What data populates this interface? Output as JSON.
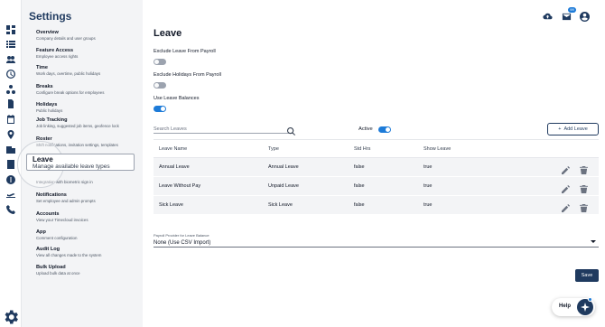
{
  "settings": {
    "title": "Settings",
    "items": [
      {
        "label": "Overview",
        "desc": "Company details and user groups"
      },
      {
        "label": "Feature Access",
        "desc": "Employee access rights"
      },
      {
        "label": "Time",
        "desc": "Work days, overtime, public holidays"
      },
      {
        "label": "Breaks",
        "desc": "Configure break options for employees"
      },
      {
        "label": "Holidays",
        "desc": "Public holidays"
      },
      {
        "label": "Job Tracking",
        "desc": "Job linking, suggested job items, geofence lock"
      },
      {
        "label": "Roster",
        "desc": "Shift notifications, invitation settings, templates"
      },
      {
        "label": "Leave",
        "desc": "Manage available leave types"
      },
      {
        "label": "",
        "desc": "Integration with biometric sign in"
      },
      {
        "label": "Notifications",
        "desc": "Set employee and admin prompts"
      },
      {
        "label": "Accounts",
        "desc": "View your Timecloud invoices"
      },
      {
        "label": "App",
        "desc": "Comment configuration"
      },
      {
        "label": "Audit Log",
        "desc": "View all changes made to the system"
      },
      {
        "label": "Bulk Upload",
        "desc": "Upload bulk data at once"
      }
    ]
  },
  "header": {
    "notification_count": "99"
  },
  "main": {
    "title": "Leave",
    "exclude_payroll_label": "Exclude Leave From Payroll",
    "exclude_holidays_label": "Exclude Holidays From Payroll",
    "use_balances_label": "Use Leave Balances",
    "toggles": {
      "exclude_payroll": false,
      "exclude_holidays": false,
      "use_balances": true,
      "active": true
    },
    "search_placeholder": "Search Leaves",
    "active_label": "Active",
    "add_button": "Add Leave",
    "table": {
      "headers": [
        "Leave Name",
        "Type",
        "Std Hrs",
        "Show Leave"
      ],
      "rows": [
        [
          "Annual Leave",
          "Annual Leave",
          "false",
          "true"
        ],
        [
          "Leave Without Pay",
          "Unpaid Leave",
          "false",
          "true"
        ],
        [
          "Sick Leave",
          "Sick Leave",
          "false",
          "true"
        ]
      ]
    },
    "payroll_provider_label": "Payroll Provider for Leave Balance",
    "payroll_provider_value": "None (Use CSV Import)",
    "save_button": "Save"
  },
  "help": {
    "label": "Help"
  },
  "colors": {
    "accent": "#1d7bd8",
    "brand": "#1f3a5f"
  }
}
